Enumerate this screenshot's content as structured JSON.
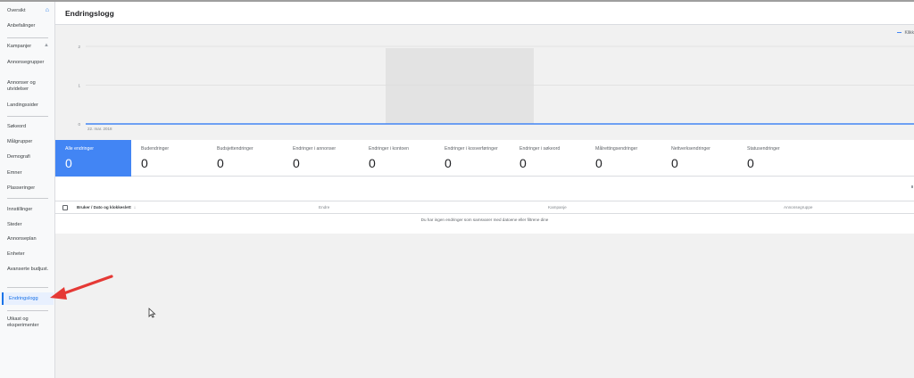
{
  "header": {
    "title": "Endringslogg"
  },
  "sidebar": {
    "items": [
      {
        "label": "Oversikt"
      },
      {
        "label": "Anbefalinger"
      },
      {
        "label": "Kampanjer"
      },
      {
        "label": "Annonsegrupper"
      },
      {
        "label": "Annonser og utvidelser"
      },
      {
        "label": "Landingssider"
      },
      {
        "label": "Søkeord"
      },
      {
        "label": "Målgrupper"
      },
      {
        "label": "Demografi"
      },
      {
        "label": "Emner"
      },
      {
        "label": "Plasseringer"
      },
      {
        "label": "Innstillinger"
      },
      {
        "label": "Steder"
      },
      {
        "label": "Annonseplan"
      },
      {
        "label": "Enheter"
      },
      {
        "label": "Avanserte budjust."
      },
      {
        "label": "Endringslogg"
      },
      {
        "label": "Utkast og eksperimenter"
      }
    ]
  },
  "chart_data": {
    "type": "line",
    "x": [
      "22. mar. 2018"
    ],
    "series": [
      {
        "name": "Klikk",
        "values": [
          0
        ]
      }
    ],
    "yticks": [
      "2",
      "1",
      "0"
    ],
    "ylim": [
      0,
      2
    ],
    "grid": true,
    "legend": "top-right"
  },
  "stats": {
    "tiles": [
      {
        "label": "Alle endringer",
        "value": "0"
      },
      {
        "label": "Budendringer",
        "value": "0"
      },
      {
        "label": "Budsjettendringer",
        "value": "0"
      },
      {
        "label": "Endringer i annonser",
        "value": "0"
      },
      {
        "label": "Endringer i kontoen",
        "value": "0"
      },
      {
        "label": "Endringer i kosverføringer",
        "value": "0"
      },
      {
        "label": "Endringer i søkeord",
        "value": "0"
      },
      {
        "label": "Målrettingsendringer",
        "value": "0"
      },
      {
        "label": "Nettverksendringer",
        "value": "0"
      },
      {
        "label": "Statusendringer",
        "value": "0"
      }
    ]
  },
  "table": {
    "columns": [
      "Bruker / Dato og klokkeslett",
      "Endre",
      "Kampanje",
      "Annonsegruppe"
    ],
    "empty_message": "Du har ingen endringer som samsvarer med datoene eller filtrene dine"
  },
  "colors": {
    "accent": "#4285f4",
    "annotation_arrow": "#e53935"
  }
}
